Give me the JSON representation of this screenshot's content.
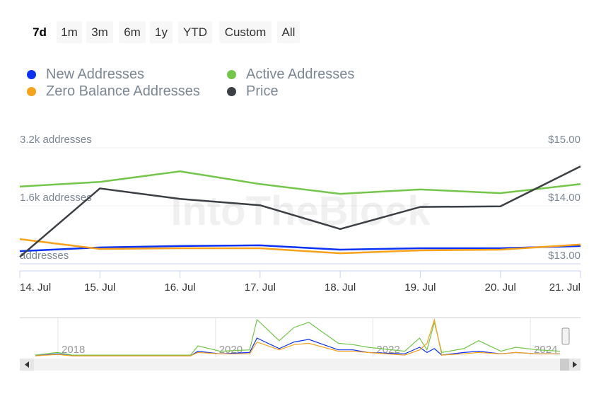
{
  "range_buttons": [
    "7d",
    "1m",
    "3m",
    "6m",
    "1y",
    "YTD",
    "Custom",
    "All"
  ],
  "selected_range": "7d",
  "legend": [
    {
      "label": "New Addresses",
      "color": "#0b31f5"
    },
    {
      "label": "Active Addresses",
      "color": "#73c64a"
    },
    {
      "label": "Zero Balance Addresses",
      "color": "#f7a21b"
    },
    {
      "label": "Price",
      "color": "#3c3f44"
    }
  ],
  "watermark": "IntoTheBlock",
  "chart_data": {
    "type": "line",
    "categories": [
      "14. Jul",
      "15. Jul",
      "16. Jul",
      "17. Jul",
      "18. Jul",
      "19. Jul",
      "20. Jul",
      "21. Jul"
    ],
    "left_axis": {
      "ticks": [
        "addresses",
        "1.6k addresses",
        "3.2k addresses"
      ],
      "range": [
        0,
        3200
      ]
    },
    "right_axis": {
      "ticks": [
        "$13.00",
        "$14.00",
        "$15.00"
      ],
      "range": [
        13,
        15
      ]
    },
    "grid": true,
    "legend_placement": "top",
    "series": [
      {
        "name": "Active Addresses",
        "axis": "left",
        "color": "#73c64a",
        "values": [
          2130,
          2260,
          2550,
          2200,
          1930,
          2050,
          1950,
          2200
        ]
      },
      {
        "name": "New Addresses",
        "axis": "left",
        "color": "#0b31f5",
        "values": [
          350,
          450,
          490,
          510,
          390,
          430,
          430,
          490
        ]
      },
      {
        "name": "Zero Balance Addresses",
        "axis": "left",
        "color": "#f7a21b",
        "values": [
          680,
          410,
          430,
          430,
          290,
          370,
          390,
          530
        ]
      },
      {
        "name": "Price",
        "axis": "right",
        "color": "#3c3f44",
        "values": [
          13.12,
          14.3,
          14.12,
          14.01,
          13.6,
          13.98,
          13.99,
          14.68
        ]
      }
    ],
    "navigator": {
      "year_labels": [
        "2018",
        "2020",
        "2022",
        "2024"
      ],
      "years": [
        2017.5,
        2017.8,
        2018,
        2019,
        2019.6,
        2019.7,
        2020,
        2020.4,
        2020.5,
        2020.8,
        2021,
        2021.2,
        2021.4,
        2021.6,
        2021.8,
        2022,
        2022.5,
        2022.7,
        2022.8,
        2022.9,
        2023,
        2023.3,
        2023.5,
        2023.8,
        2024,
        2024.3,
        2024.6
      ],
      "active": [
        1,
        3,
        1,
        1,
        1,
        8,
        4,
        5,
        28,
        12,
        22,
        26,
        18,
        10,
        9,
        7,
        4,
        14,
        5,
        26,
        3,
        6,
        12,
        4,
        7,
        5,
        4
      ],
      "new": [
        0.5,
        2,
        0.5,
        0.5,
        0.5,
        4,
        2,
        3,
        14,
        6,
        11,
        13,
        9,
        5,
        5,
        3,
        2,
        7,
        3,
        6,
        1,
        3,
        4,
        2,
        3,
        2,
        2
      ],
      "zero": [
        0.5,
        1.5,
        0.5,
        0.5,
        0.5,
        3,
        2,
        2,
        11,
        5,
        9,
        10,
        7,
        4,
        4,
        3,
        1,
        5,
        10,
        28,
        1,
        2,
        3,
        2,
        3,
        2,
        2
      ]
    }
  }
}
